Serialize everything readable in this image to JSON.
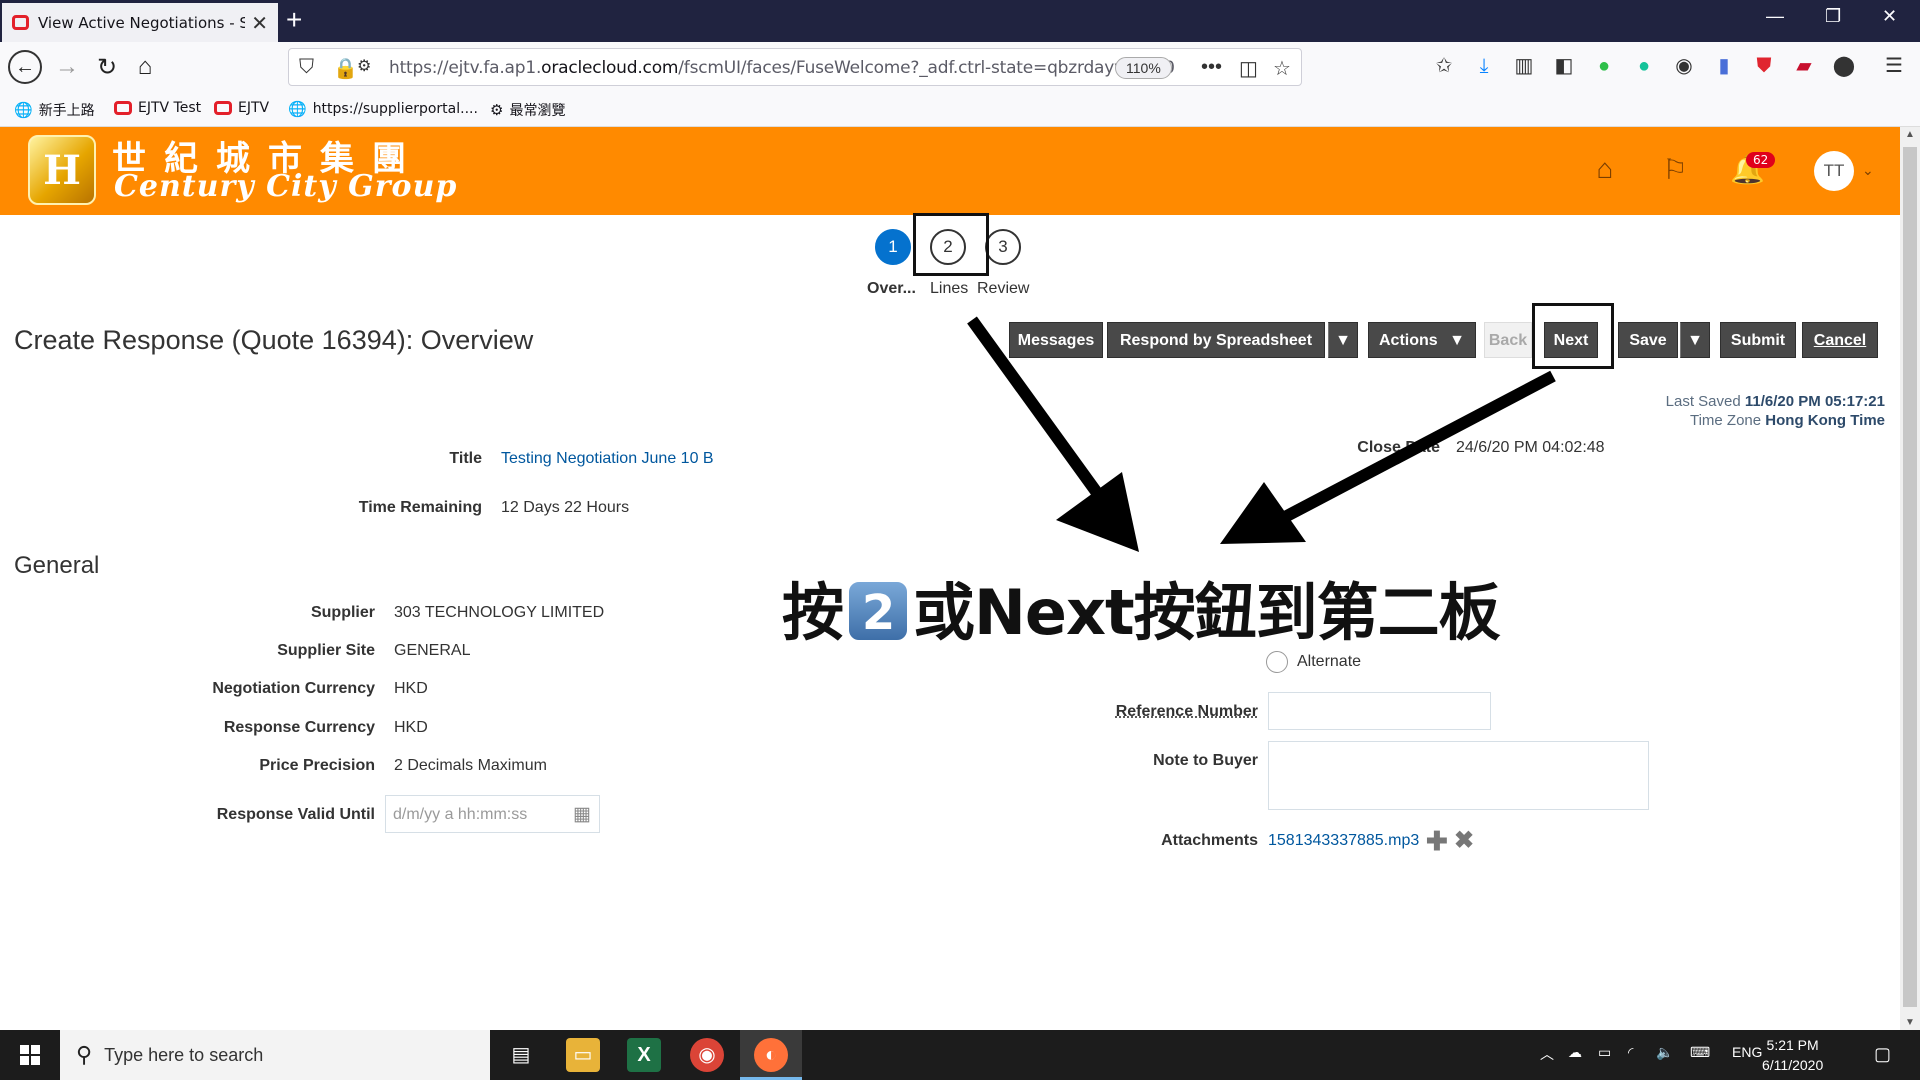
{
  "browser": {
    "tab_title": "View Active Negotiations - Sup",
    "url_prefix": "https://ejtv.fa.ap1.",
    "url_domain": "oraclecloud.com",
    "url_rest": "/fscmUI/faces/FuseWelcome?_adf.ctrl-state=qbzrdayv1_100",
    "zoom": "110%",
    "bookmarks": [
      "新手上路",
      "EJTV Test",
      "EJTV",
      "https://supplierportal....",
      "最常瀏覽"
    ]
  },
  "header": {
    "company_cn": "世紀城市集團",
    "company_en": "Century City Group",
    "notification_count": "62",
    "user_initials": "TT"
  },
  "train": {
    "stops": [
      {
        "num": "1",
        "label": "Over..."
      },
      {
        "num": "2",
        "label": "Lines"
      },
      {
        "num": "3",
        "label": "Review"
      }
    ]
  },
  "page": {
    "title": "Create Response (Quote 16394): Overview",
    "buttons": {
      "messages": "Messages",
      "respond_spreadsheet": "Respond by Spreadsheet",
      "actions": "Actions",
      "back": "Back",
      "next": "Next",
      "save": "Save",
      "submit": "Submit",
      "cancel": "Cancel"
    },
    "last_saved_label": "Last Saved",
    "last_saved_value": "11/6/20 PM 05:17:21",
    "timezone_label": "Time Zone",
    "timezone_value": "Hong Kong Time",
    "close_date_label": "Close Date",
    "close_date_value": "24/6/20 PM 04:02:48",
    "title_label": "Title",
    "title_value": "Testing Negotiation June 10 B",
    "time_remaining_label": "Time Remaining",
    "time_remaining_value": "12 Days 22 Hours",
    "general_heading": "General",
    "general": [
      {
        "label": "Supplier",
        "value": "303 TECHNOLOGY LIMITED"
      },
      {
        "label": "Supplier Site",
        "value": "GENERAL"
      },
      {
        "label": "Negotiation Currency",
        "value": "HKD"
      },
      {
        "label": "Response Currency",
        "value": "HKD"
      },
      {
        "label": "Price Precision",
        "value": "2 Decimals Maximum"
      }
    ],
    "valid_until_label": "Response Valid Until",
    "valid_until_placeholder": "d/m/yy a hh:mm:ss",
    "alternate_label": "Alternate",
    "reference_label": "Reference Number",
    "reference_value": "",
    "note_label": "Note to Buyer",
    "note_value": "",
    "attachments_label": "Attachments",
    "attachment_file": "1581343337885.mp3"
  },
  "annotation": {
    "text_before": "按",
    "key": "2",
    "text_after": "或Next按鈕到第二板"
  },
  "taskbar": {
    "search_placeholder": "Type here to search",
    "time": "5:21 PM",
    "date": "6/11/2020",
    "language": "ENG"
  }
}
